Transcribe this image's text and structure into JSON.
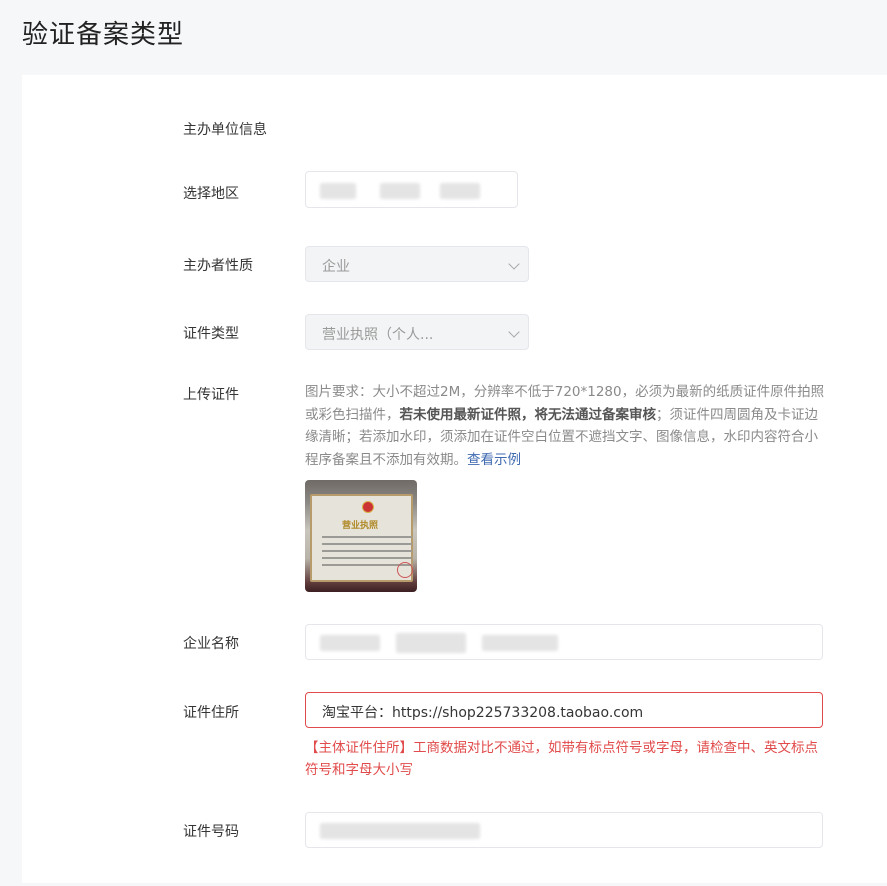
{
  "page": {
    "title": "验证备案类型"
  },
  "form": {
    "section_title": "主办单位信息",
    "region": {
      "label": "选择地区"
    },
    "nature": {
      "label": "主办者性质",
      "value": "企业"
    },
    "cert_type": {
      "label": "证件类型",
      "value": "营业执照（个人..."
    },
    "upload": {
      "label": "上传证件",
      "hint_part1": "图片要求：大小不超过2M，分辨率不低于720*1280，必须为最新的纸质证件原件拍照或彩色扫描件，",
      "hint_bold": "若未使用最新证件照，将无法通过备案审核",
      "hint_part2": "；须证件四周圆角及卡证边缘清晰；若添加水印，须添加在证件空白位置不遮挡文字、图像信息，水印内容符合小程序备案且不添加有效期。",
      "example_link": "查看示例",
      "thumb_text": "营业执照"
    },
    "company_name": {
      "label": "企业名称"
    },
    "address": {
      "label": "证件住所",
      "value": "淘宝平台：https://shop225733208.taobao.com",
      "error": "【主体证件住所】工商数据对比不通过，如带有标点符号或字母，请检查中、英文标点符号和字母大小写"
    },
    "cert_number": {
      "label": "证件号码"
    }
  },
  "colors": {
    "error": "#e14b4b",
    "link": "#3f6ab0",
    "background": "#f6f7f9"
  }
}
